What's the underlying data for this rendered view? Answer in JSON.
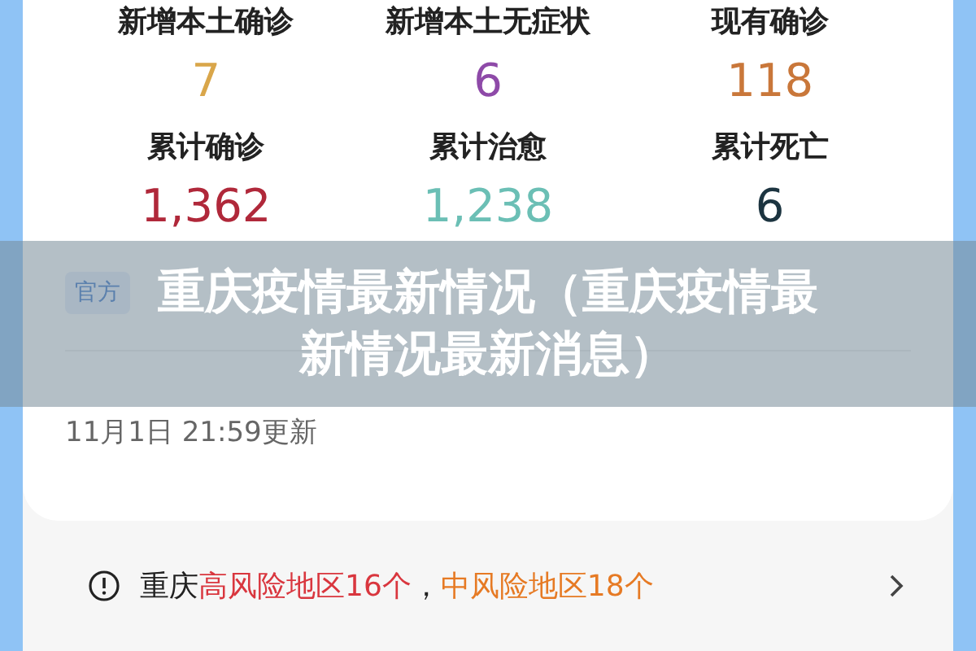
{
  "stats": [
    {
      "label": "新增本土确诊",
      "value": "7",
      "color": "#d9a64a"
    },
    {
      "label": "新增本土无症状",
      "value": "6",
      "color": "#8e4aa8"
    },
    {
      "label": "现有确诊",
      "value": "118",
      "color": "#c9773a"
    },
    {
      "label": "累计确诊",
      "value": "1,362",
      "color": "#b0283a"
    },
    {
      "label": "累计治愈",
      "value": "1,238",
      "color": "#6bbfb5"
    },
    {
      "label": "累计死亡",
      "value": "6",
      "color": "#1c3440"
    }
  ],
  "source": {
    "badge": "官方"
  },
  "updated": "11月1日 21:59更新",
  "alert": {
    "segments": [
      {
        "text": "重庆",
        "color": "#222222"
      },
      {
        "text": "高风险地区16个",
        "color": "#d9363e"
      },
      {
        "text": "，",
        "color": "#222222"
      },
      {
        "text": "中风险地区18个",
        "color": "#e67a24"
      }
    ]
  },
  "banner": {
    "title": "重庆疫情最新情况（重庆疫情最新情况最新消息）"
  }
}
